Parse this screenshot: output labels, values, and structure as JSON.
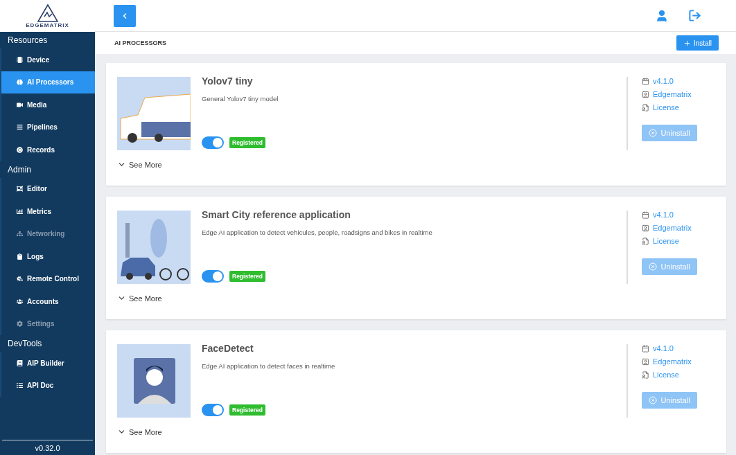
{
  "logo": {
    "text": "EDGEMATRIX"
  },
  "sidebar": {
    "sections": [
      {
        "title": "Resources",
        "items": [
          {
            "label": "Device",
            "selected": false,
            "disabled": false
          },
          {
            "label": "AI Processors",
            "selected": true,
            "disabled": false
          },
          {
            "label": "Media",
            "selected": false,
            "disabled": false
          },
          {
            "label": "Pipelines",
            "selected": false,
            "disabled": false
          },
          {
            "label": "Records",
            "selected": false,
            "disabled": false
          }
        ]
      },
      {
        "title": "Admin",
        "items": [
          {
            "label": "Editor",
            "selected": false,
            "disabled": false
          },
          {
            "label": "Metrics",
            "selected": false,
            "disabled": false
          },
          {
            "label": "Networking",
            "selected": false,
            "disabled": true
          },
          {
            "label": "Logs",
            "selected": false,
            "disabled": false
          },
          {
            "label": "Remote Control",
            "selected": false,
            "disabled": false
          },
          {
            "label": "Accounts",
            "selected": false,
            "disabled": false
          },
          {
            "label": "Settings",
            "selected": false,
            "disabled": true
          }
        ]
      },
      {
        "title": "DevTools",
        "items": [
          {
            "label": "AIP Builder",
            "selected": false,
            "disabled": false
          },
          {
            "label": "API Doc",
            "selected": false,
            "disabled": false
          }
        ]
      }
    ],
    "version": "v0.32.0"
  },
  "page": {
    "title": "AI PROCESSORS",
    "install_button": "Install"
  },
  "processors": [
    {
      "name": "Yolov7 tiny",
      "description": "General Yolov7 tiny model",
      "on": true,
      "badge": "Registered",
      "see_more": "See More",
      "version": "v4.1.0",
      "author": "Edgematrix",
      "license": "License",
      "uninstall": "Uninstall",
      "uninstall_disabled": true
    },
    {
      "name": "Smart City reference application",
      "description": "Edge AI application to detect vehicules, people, roadsigns and bikes in realtime",
      "on": true,
      "badge": "Registered",
      "see_more": "See More",
      "version": "v4.1.0",
      "author": "Edgematrix",
      "license": "License",
      "uninstall": "Uninstall",
      "uninstall_disabled": true
    },
    {
      "name": "FaceDetect",
      "description": "Edge AI application to detect faces in realtime",
      "on": true,
      "badge": "Registered",
      "see_more": "See More",
      "version": "v4.1.0",
      "author": "Edgematrix",
      "license": "License",
      "uninstall": "Uninstall",
      "uninstall_disabled": true
    }
  ]
}
